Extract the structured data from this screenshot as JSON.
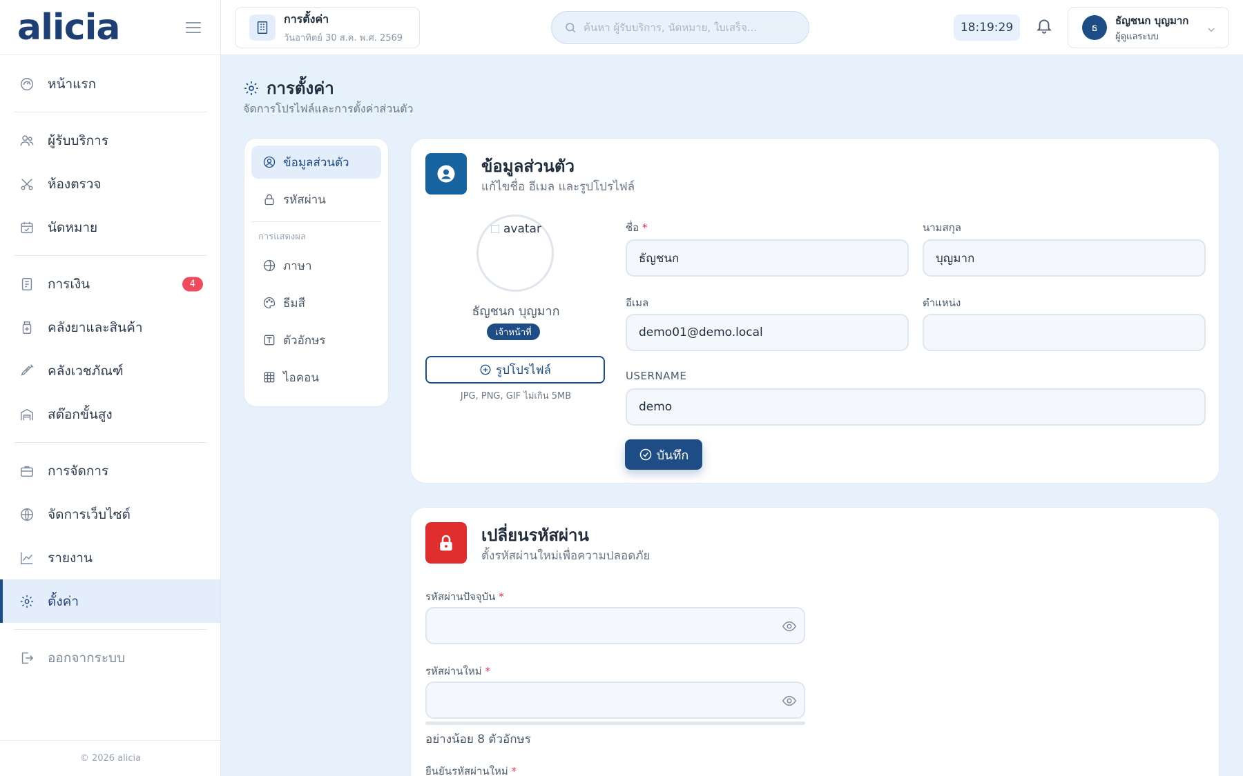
{
  "app": {
    "logo": "alicia",
    "copyright": "© 2026 alicia"
  },
  "sidebar": {
    "items": [
      {
        "label": "หน้าแรก",
        "icon": "gauge-icon"
      },
      {
        "label": "ผู้รับบริการ",
        "icon": "users-icon"
      },
      {
        "label": "ห้องตรวจ",
        "icon": "scissors-icon"
      },
      {
        "label": "นัดหมาย",
        "icon": "calendar-icon"
      },
      {
        "label": "การเงิน",
        "icon": "receipt-icon",
        "badge": "4"
      },
      {
        "label": "คลังยาและสินค้า",
        "icon": "medicine-icon"
      },
      {
        "label": "คลังเวชภัณฑ์",
        "icon": "syringe-icon"
      },
      {
        "label": "สต๊อกขั้นสูง",
        "icon": "warehouse-icon"
      },
      {
        "label": "การจัดการ",
        "icon": "briefcase-icon"
      },
      {
        "label": "จัดการเว็บไซต์",
        "icon": "globe-icon"
      },
      {
        "label": "รายงาน",
        "icon": "chart-icon"
      },
      {
        "label": "ตั้งค่า",
        "icon": "gear-icon",
        "active": true
      }
    ],
    "logout": "ออกจากระบบ"
  },
  "topbar": {
    "page_title": "การตั้งค่า",
    "date": "วันอาทิตย์ 30 ส.ค. พ.ศ. 2569",
    "search_placeholder": "ค้นหา ผู้รับบริการ, นัดหมาย, ใบเสร็จ...",
    "clock": "18:19:29",
    "user_initial": "ธ",
    "user_name": "ธัญชนก บุญมาก",
    "user_role": "ผู้ดูแลระบบ"
  },
  "page": {
    "title": "การตั้งค่า",
    "subtitle": "จัดการโปรไฟล์และการตั้งค่าส่วนตัว"
  },
  "subnav": {
    "profile": "ข้อมูลส่วนตัว",
    "password": "รหัสผ่าน",
    "display_heading": "การแสดงผล",
    "language": "ภาษา",
    "theme": "ธีมสี",
    "font": "ตัวอักษร",
    "icons": "ไอคอน"
  },
  "profile_card": {
    "title": "ข้อมูลส่วนตัว",
    "subtitle": "แก้ไขชื่อ อีเมล และรูปโปรไฟล์",
    "avatar_alt": "avatar",
    "display_name": "ธัญชนก บุญมาก",
    "role_badge": "เจ้าหน้าที่",
    "upload_label": "รูปโปรไฟล์",
    "upload_hint": "JPG, PNG, GIF ไม่เกิน 5MB",
    "first_name_label": "ชื่อ",
    "first_name": "ธัญชนก",
    "last_name_label": "นามสกุล",
    "last_name": "บุญมาก",
    "email_label": "อีเมล",
    "email": "demo01@demo.local",
    "position_label": "ตำแหน่ง",
    "position": "",
    "username_label": "USERNAME",
    "username": "demo",
    "save_label": "บันทึก",
    "required_mark": "*"
  },
  "password_card": {
    "title": "เปลี่ยนรหัสผ่าน",
    "subtitle": "ตั้งรหัสผ่านใหม่เพื่อความปลอดภัย",
    "current_label": "รหัสผ่านปัจจุบัน",
    "new_label": "รหัสผ่านใหม่",
    "hint": "อย่างน้อย 8 ตัวอักษร",
    "confirm_label": "ยืนยันรหัสผ่านใหม่"
  },
  "colors": {
    "primary": "#1e4d86",
    "background": "#e6f1fb",
    "badge": "#ef4b5d",
    "danger": "#e02d2d",
    "profile_icon_bg": "#17639f"
  }
}
